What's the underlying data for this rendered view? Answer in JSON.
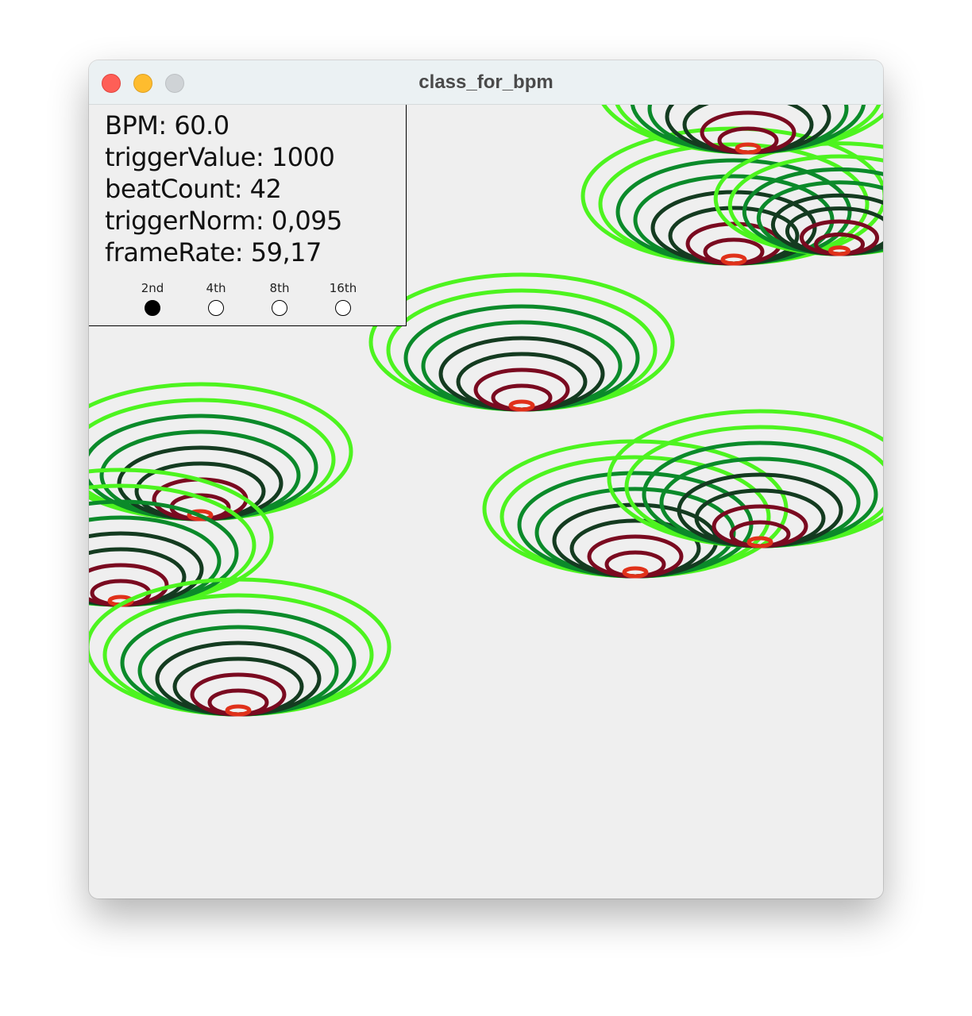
{
  "window": {
    "title": "class_for_bpm"
  },
  "hud": {
    "lines": [
      "BPM: 60.0",
      "triggerValue: 1000",
      "beatCount: 42",
      "triggerNorm: 0,095",
      "frameRate: 59,17"
    ]
  },
  "divisions": {
    "options": [
      {
        "label": "2nd",
        "selected": true
      },
      {
        "label": "4th",
        "selected": false
      },
      {
        "label": "8th",
        "selected": false
      },
      {
        "label": "16th",
        "selected": false
      }
    ]
  },
  "colors": {
    "background": "#efefef",
    "ring_outer": "#4df41f",
    "ring_mid": "#0b8a2a",
    "ring_dark": "#143b20",
    "ring_inner": "#7a0a20",
    "ring_core": "#e0311a"
  }
}
